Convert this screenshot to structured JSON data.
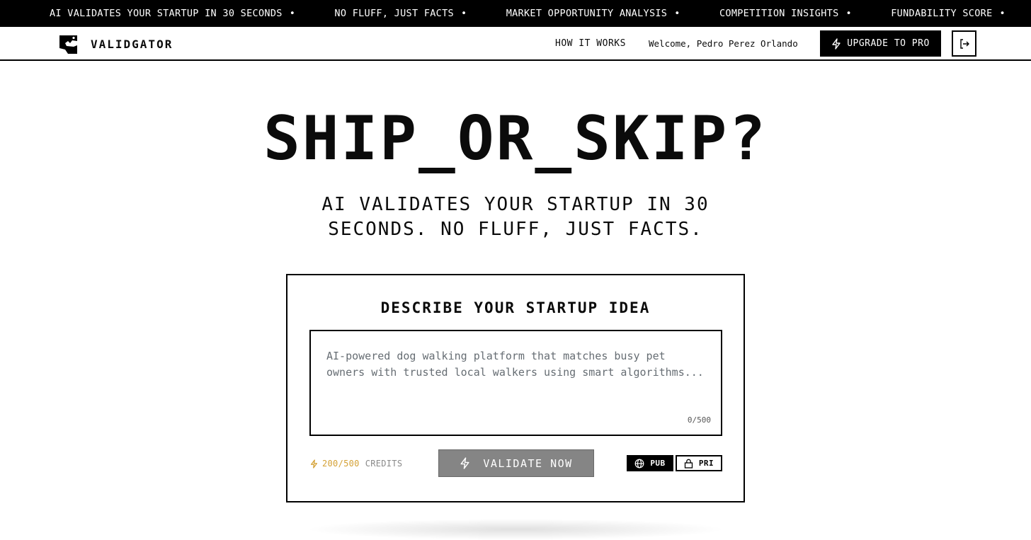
{
  "ticker": {
    "items": [
      "AI VALIDATES YOUR STARTUP IN 30 SECONDS",
      "NO FLUFF, JUST FACTS",
      "MARKET OPPORTUNITY ANALYSIS",
      "COMPETITION INSIGHTS",
      "FUNDABILITY SCORE"
    ],
    "separator": "•"
  },
  "nav": {
    "brand": "VALIDGATOR",
    "how_it_works": "HOW IT WORKS",
    "welcome": "Welcome, Pedro Perez Orlando",
    "upgrade_label": "UPGRADE TO PRO"
  },
  "hero": {
    "title": "SHIP_OR_SKIP?",
    "subtitle": "AI VALIDATES YOUR STARTUP IN 30 SECONDS. NO FLUFF, JUST FACTS."
  },
  "form": {
    "title": "DESCRIBE YOUR STARTUP IDEA",
    "placeholder": "AI-powered dog walking platform that matches busy pet owners with trusted local walkers using smart algorithms...",
    "value": "",
    "char_count": "0/500",
    "credits_amount": "200/500",
    "credits_label": "CREDITS",
    "validate_label": "VALIDATE NOW",
    "visibility_public": "PUB",
    "visibility_private": "PRI",
    "visibility_selected": "PUB"
  },
  "colors": {
    "primary": "#000000",
    "background": "#ffffff",
    "credits_accent": "#d4a135",
    "disabled_button": "#858585"
  },
  "icons": {
    "brand": "gator-logo-icon",
    "upgrade": "lightning-icon",
    "logout": "logout-icon",
    "credits": "lightning-icon",
    "validate": "lightning-icon",
    "public": "globe-icon",
    "private": "lock-icon"
  }
}
